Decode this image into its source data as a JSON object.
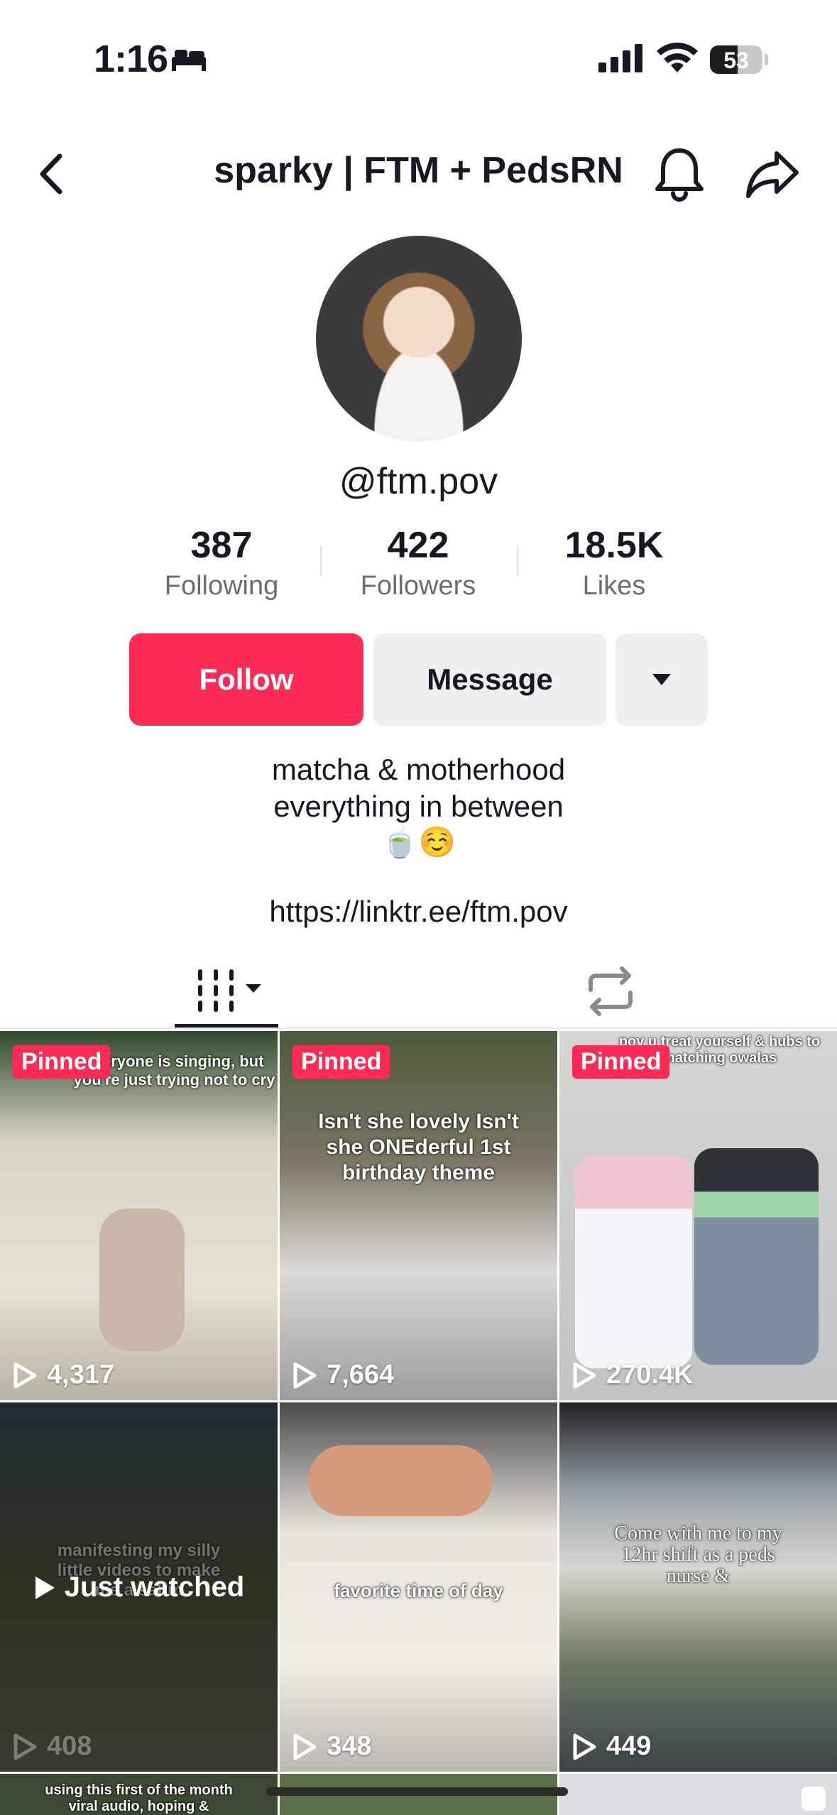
{
  "status_bar": {
    "time": "1:16",
    "battery": "53",
    "battery_level": 0.53
  },
  "header": {
    "title": "sparky | FTM + PedsRN"
  },
  "profile": {
    "handle": "@ftm.pov",
    "stats": [
      {
        "value": "387",
        "label": "Following"
      },
      {
        "value": "422",
        "label": "Followers"
      },
      {
        "value": "18.5K",
        "label": "Likes"
      }
    ],
    "follow_label": "Follow",
    "message_label": "Message",
    "bio": [
      "matcha & motherhood",
      "everything in between",
      "🍵☺️"
    ],
    "link": "https://linktr.ee/ftm.pov"
  },
  "videos": [
    {
      "pinned": "Pinned",
      "views": "4,317",
      "caption": "everyone is singing, but you're just trying not to cry"
    },
    {
      "pinned": "Pinned",
      "views": "7,664",
      "caption": "Isn't she lovely Isn't she ONEderful 1st birthday theme"
    },
    {
      "pinned": "Pinned",
      "views": "270.4K",
      "caption": "pov u treat yourself & hubs to matching owalas"
    },
    {
      "views": "408",
      "caption": "manifesting my silly little videos to make me a sahm",
      "overlay": "Just watched"
    },
    {
      "views": "348",
      "caption": "favorite time of day"
    },
    {
      "views": "449",
      "caption": "Come with me to my 12hr shift as a peds nurse &"
    },
    {
      "caption": "using this first of the month viral audio, hoping &"
    }
  ],
  "colors": {
    "accent": "#fe2c55",
    "secondary_button": "#efeff2",
    "text": "#161823"
  }
}
